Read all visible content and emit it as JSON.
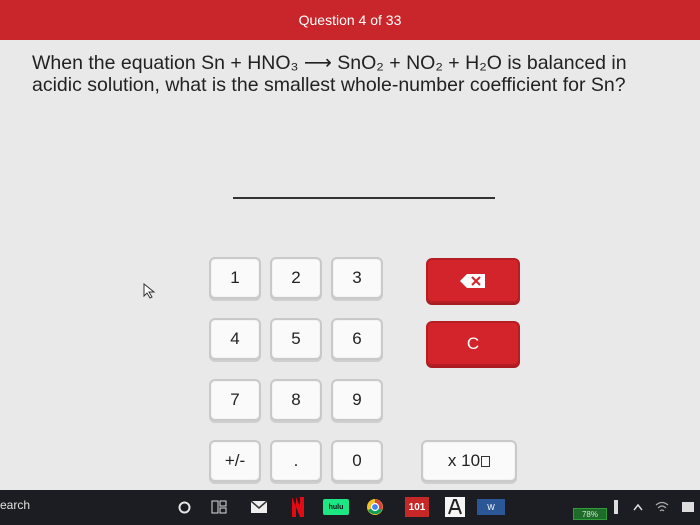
{
  "header": {
    "progress_label": "Question 4 of 33"
  },
  "question": {
    "text": "When the equation Sn + HNO₃ ⟶ SnO₂ + NO₂ + H₂O is balanced in acidic solution, what is the smallest whole-number coefficient for Sn?"
  },
  "answer": {
    "value": ""
  },
  "keypad": {
    "keys": [
      "1",
      "2",
      "3",
      "4",
      "5",
      "6",
      "7",
      "8",
      "9",
      "+/-",
      ".",
      "0"
    ],
    "clear_label": "C",
    "x100_label": "x 10"
  },
  "taskbar": {
    "search_text": "earch",
    "app_101_label": "101",
    "app_hulu_label": "hulu",
    "app_w_label": "W",
    "battery_label": "78%"
  },
  "colors": {
    "accent": "#c8262b",
    "button_red": "#d3242b",
    "background": "#e9e9ea"
  }
}
